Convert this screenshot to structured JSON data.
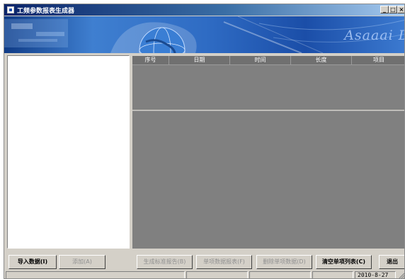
{
  "window": {
    "title": "工频参数报表生成器",
    "controls": {
      "minimize": "_",
      "maximize": "□",
      "close": "×"
    }
  },
  "banner": {
    "brand_text": "Asaaai D"
  },
  "table": {
    "columns": [
      "序号",
      "日期",
      "时间",
      "长度",
      "项目"
    ]
  },
  "buttons": {
    "import": "导入数据(I)",
    "add": "添加(A)",
    "generate_report": "生成标准报告(B)",
    "single_report": "单项数据报表(F)",
    "delete_single": "删除单项数据(D)",
    "clear_list": "清空单项列表(C)",
    "exit": "退出"
  },
  "statusbar": {
    "date": "2010-8-27"
  },
  "colors": {
    "title_active": "#0a246a",
    "face": "#d4d0c8",
    "grid_bg": "#808080"
  }
}
